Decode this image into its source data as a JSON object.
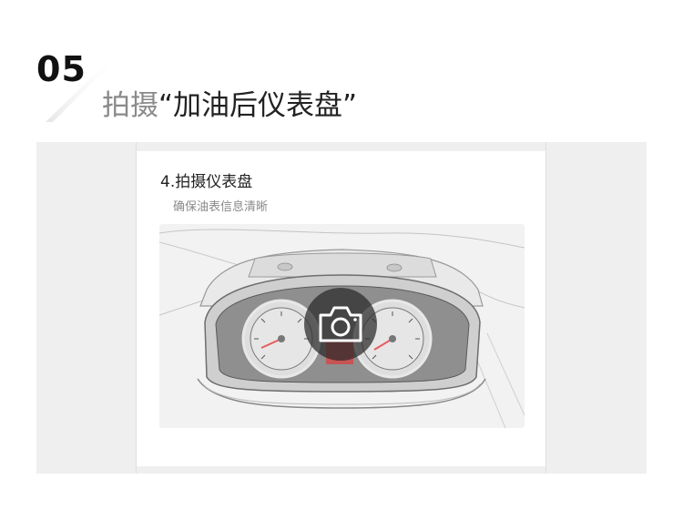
{
  "step": {
    "number": "05",
    "title_prefix": "拍摄",
    "title_main": "“加油后仪表盘”"
  },
  "card": {
    "title": "4.拍摄仪表盘",
    "subtitle": "确保油表信息清晰"
  },
  "icons": {
    "camera": "camera-icon"
  },
  "colors": {
    "needle": "#e85b5b",
    "overlay": "#2a2a2a",
    "panel_bg": "#efefef"
  }
}
